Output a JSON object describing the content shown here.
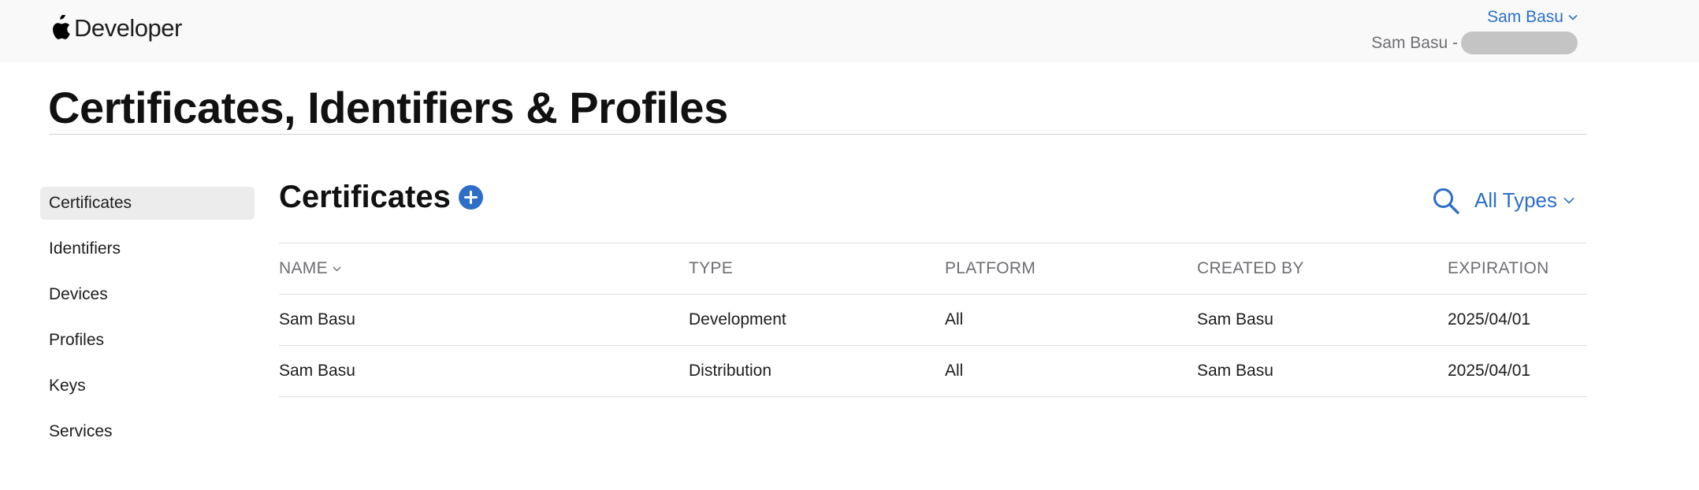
{
  "header": {
    "brand": "Developer",
    "account_name": "Sam Basu",
    "team_label": "Sam Basu -"
  },
  "page": {
    "title": "Certificates, Identifiers & Profiles"
  },
  "sidebar": {
    "items": [
      {
        "label": "Certificates",
        "active": true
      },
      {
        "label": "Identifiers"
      },
      {
        "label": "Devices"
      },
      {
        "label": "Profiles"
      },
      {
        "label": "Keys"
      },
      {
        "label": "Services"
      }
    ]
  },
  "section": {
    "title": "Certificates",
    "filter_label": "All Types"
  },
  "table": {
    "columns": [
      "NAME",
      "TYPE",
      "PLATFORM",
      "CREATED BY",
      "EXPIRATION"
    ],
    "rows": [
      [
        "Sam Basu",
        "Development",
        "All",
        "Sam Basu",
        "2025/04/01"
      ],
      [
        "Sam Basu",
        "Distribution",
        "All",
        "Sam Basu",
        "2025/04/01"
      ]
    ]
  },
  "icons": {
    "logo": "apple-logo-icon",
    "add": "plus-circle-icon",
    "search": "search-icon",
    "dropdown": "chevron-down-icon"
  },
  "colors": {
    "accent": "#2d6fc7",
    "header_bg": "#f9f9f9",
    "active_item_bg": "#ececec"
  }
}
